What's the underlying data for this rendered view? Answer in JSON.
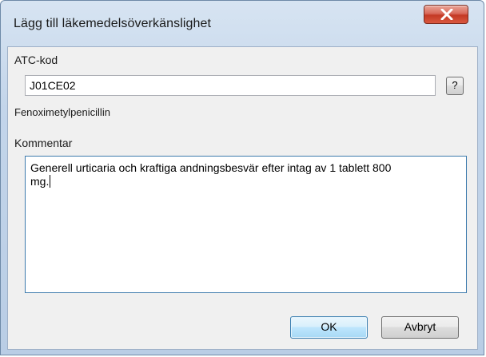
{
  "dialog": {
    "title": "Lägg till läkemedelsöverkänslighet",
    "close_glyph": "X"
  },
  "atc": {
    "label": "ATC-kod",
    "value": "J01CE02",
    "help_button": "?",
    "substance_name": "Fenoximetylpenicillin"
  },
  "comment": {
    "label": "Kommentar",
    "line1": "Generell urticaria och kraftiga andningsbesvär efter intag av 1 tablett 800",
    "line2": "mg."
  },
  "buttons": {
    "ok": "OK",
    "cancel": "Avbryt"
  },
  "colors": {
    "close_button": "#c43a25",
    "focus_border": "#3d7bad",
    "default_button": "#3c7fb1"
  },
  "icons": {
    "close": "close-icon"
  }
}
